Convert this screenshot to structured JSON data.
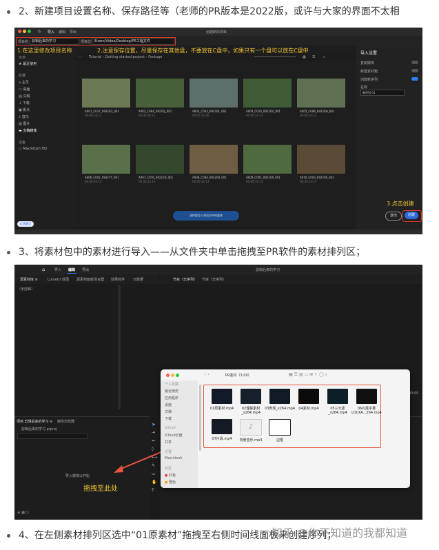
{
  "steps": {
    "step2": "2、新建项目设置名称、保存路径等（老师的PR版本是2022版，或许与大家的界面不太相",
    "step3": "3、将素材包中的素材进行导入——从文件夹中单击拖拽至PR软件的素材排列区；",
    "step4": "4、在左侧素材排列区选中“01原素材”拖拽至右侧时间线面板来创建序列；"
  },
  "watermark": "知乎 @你不知道的我都知道",
  "screenshot1": {
    "window_title": "创建新的项目",
    "top_tabs": [
      "导入",
      "编辑",
      "导出"
    ],
    "project_name_label": "项目名",
    "project_name_value": "剪辑后来的学习",
    "location_label": "项目位置",
    "location_value": "/Users/Video/Desktop/PR工程文件",
    "annotation1": "1.在这里修改项目名称",
    "annotation2": "2.注意保存位置，尽量保存在其他盘，不要放在C盘中，如果只有一个盘可以放在C盘中",
    "annotation3": "3.点击创建",
    "sidebar": {
      "section_recent": "本地",
      "recent_item": "最近使用",
      "section_device": "收藏",
      "items": [
        "主页",
        "桌面",
        "文稿",
        "下载",
        "影片",
        "音乐",
        "图片",
        "文稿媒体"
      ],
      "section_volumes": "设备",
      "volume": "Macintosh HD",
      "feedback": "反馈意见"
    },
    "breadcrumb": "Tutorial › Getting-started-project › Footage",
    "thumbnails": [
      {
        "name": "A001_C037_0922FG_001",
        "meta": "00:00:14:13",
        "color": "#6b7a55"
      },
      {
        "name": "A002_C064_09220J_001",
        "meta": "00:00:14:13",
        "color": "#47603a"
      },
      {
        "name": "A003_C003_092201_001",
        "meta": "00:00:12:20",
        "color": "#5d6f6a"
      },
      {
        "name": "A004_C010_09220U_001",
        "meta": "00:00:14:13",
        "color": "#3f5a35"
      },
      {
        "name": "A005_C008_0922RH_001",
        "meta": "00:00:14:13",
        "color": "#607052"
      },
      {
        "name": "A006_C002_09227T_001",
        "meta": "00:00:09:13",
        "color": "#59704b"
      },
      {
        "name": "A007_C076_09222D_001",
        "meta": "00:00:14:13",
        "color": "#34482d"
      },
      {
        "name": "A008_C064_092200_001",
        "meta": "00:00:14:13",
        "color": "#6e5c43"
      },
      {
        "name": "A009_C001_09220X_001",
        "meta": "00:00:14:13",
        "color": "#4f6a3e"
      },
      {
        "name": "A010_C003_092206_001",
        "meta": "00:00:14:13",
        "color": "#5a4a36"
      }
    ],
    "right_panel": {
      "title": "导入设置",
      "opt1": "复制媒体",
      "opt2": "新建素材箱",
      "opt3": "创建新序列",
      "name_label": "名称",
      "name_value": "新序列 01"
    },
    "bottom_pill": "选择要导入到项目中的媒体",
    "exit_button": "退出",
    "create_button": "创建"
  },
  "screenshot2": {
    "window_title": "剪辑后来的学习",
    "top_tabs": [
      "导入",
      "编辑",
      "导出"
    ],
    "left_tabs": [
      "源素材库 ≡",
      "Lumetri 范围",
      "源素材面板混合器",
      "效果控件",
      "元数据"
    ],
    "source_placeholder": "（无剪辑）",
    "program_tabs": [
      "节目（无序列）",
      "节目（无序列）"
    ],
    "project_tabs": [
      "项目  剪辑后来的学习 ≡",
      "媒体浏览器"
    ],
    "project_file": "剪辑后来的学习.prproj",
    "project_hint": "导入媒体以开始",
    "drag_annotation": "拖拽至此处",
    "finder": {
      "title": "PR素材（3.00）",
      "sidebar_sections": [
        "个人收藏",
        "iCloud",
        "位置",
        "标签"
      ],
      "sidebar_items": [
        "最近使用",
        "应用程序",
        "桌面",
        "文稿",
        "下载",
        "iCloud云盘",
        "共享",
        "Macintosh",
        "红色",
        "橙色"
      ],
      "files": [
        {
          "name": "01原素材.mp4",
          "color": "#111827"
        },
        {
          "name": "02理解素材_x264.mp4",
          "color": "#16202a"
        },
        {
          "name": "03表现_x264.mp4",
          "color": "#0f1a24"
        },
        {
          "name": "04素材.mp4",
          "color": "#0b0b0b"
        },
        {
          "name": "05三元素_x264.mp4",
          "color": "#0c1e26"
        },
        {
          "name": "06片尾字幕LOCKA...264.mp4",
          "color": "#101010"
        },
        {
          "name": "07片段.mp4",
          "color": "#131a24"
        },
        {
          "name": "背景音乐.mp3",
          "color": "#eeeeee"
        },
        {
          "name": "边框",
          "color": "#ffffff"
        }
      ]
    },
    "timecode": "00:00"
  }
}
